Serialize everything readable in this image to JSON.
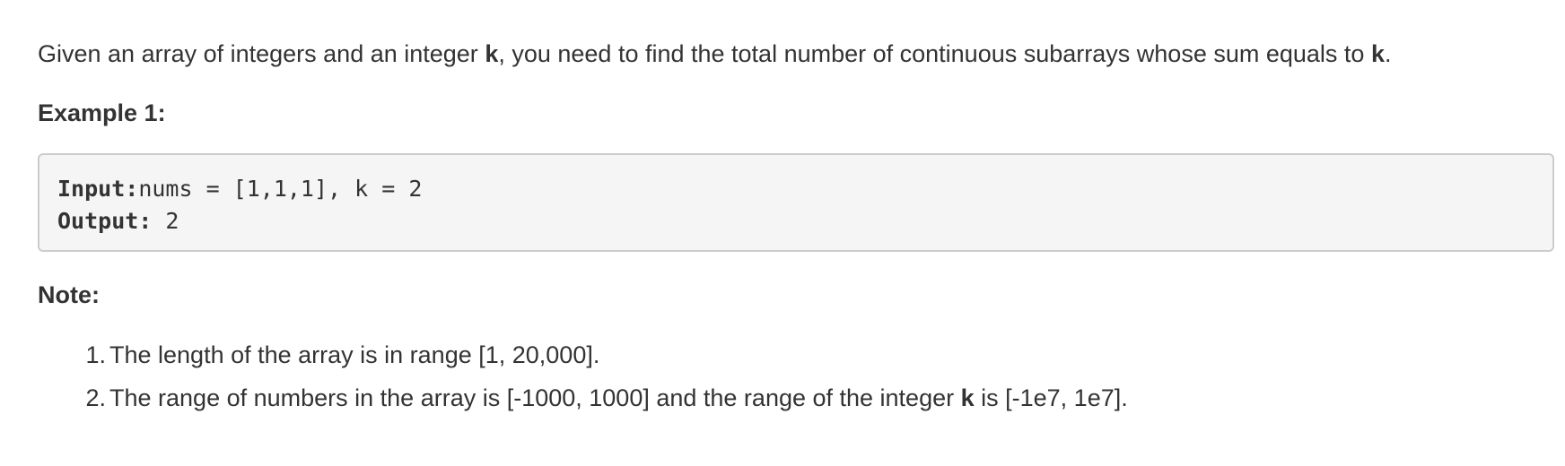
{
  "problem": {
    "intro_part1": "Given an array of integers and an integer ",
    "intro_k1": "k",
    "intro_part2": ", you need to find the total number of continuous subarrays whose sum equals to ",
    "intro_k2": "k",
    "intro_part3": "."
  },
  "example": {
    "heading": "Example 1:",
    "input_label": "Input:",
    "input_value": "nums = [1,1,1], k = 2",
    "output_label": "Output:",
    "output_value": " 2"
  },
  "note": {
    "heading": "Note:",
    "items": [
      {
        "number": "1.",
        "text_part1": "The length of the array is in range [1, 20,000]."
      },
      {
        "number": "2.",
        "text_part1": "The range of numbers in the array is [-1000, 1000] and the range of the integer ",
        "text_k": "k",
        "text_part2": " is [-1e7, 1e7]."
      }
    ]
  }
}
